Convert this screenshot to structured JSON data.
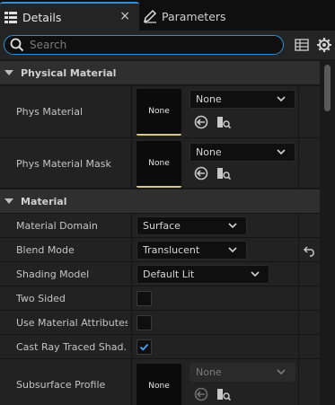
{
  "tabs": [
    {
      "label": "Details",
      "icon": "details-icon",
      "active": true,
      "close": "×"
    },
    {
      "label": "Parameters",
      "icon": "pencil-icon",
      "active": false
    }
  ],
  "search": {
    "placeholder": "Search"
  },
  "sections": {
    "physical_material": {
      "title": "Physical Material",
      "rows": {
        "phys_material": {
          "label": "Phys Material",
          "thumb": "None",
          "value": "None"
        },
        "phys_material_mask": {
          "label": "Phys Material Mask",
          "thumb": "None",
          "value": "None"
        }
      }
    },
    "material": {
      "title": "Material",
      "rows": {
        "material_domain": {
          "label": "Material Domain",
          "value": "Surface"
        },
        "blend_mode": {
          "label": "Blend Mode",
          "value": "Translucent"
        },
        "shading_model": {
          "label": "Shading Model",
          "value": "Default Lit"
        },
        "two_sided": {
          "label": "Two Sided",
          "checked": false
        },
        "use_material_attributes": {
          "label": "Use Material Attributes",
          "checked": false
        },
        "cast_ray_traced_shadows": {
          "label": "Cast Ray Traced Shad...",
          "checked": true
        },
        "subsurface_profile": {
          "label": "Subsurface Profile",
          "thumb": "None",
          "value": "None",
          "disabled": true
        }
      }
    }
  },
  "colors": {
    "accent": "#2e8fd8",
    "thumb_underline": "#d9c48a",
    "panel": "#222222",
    "section": "#2f2f2f"
  }
}
